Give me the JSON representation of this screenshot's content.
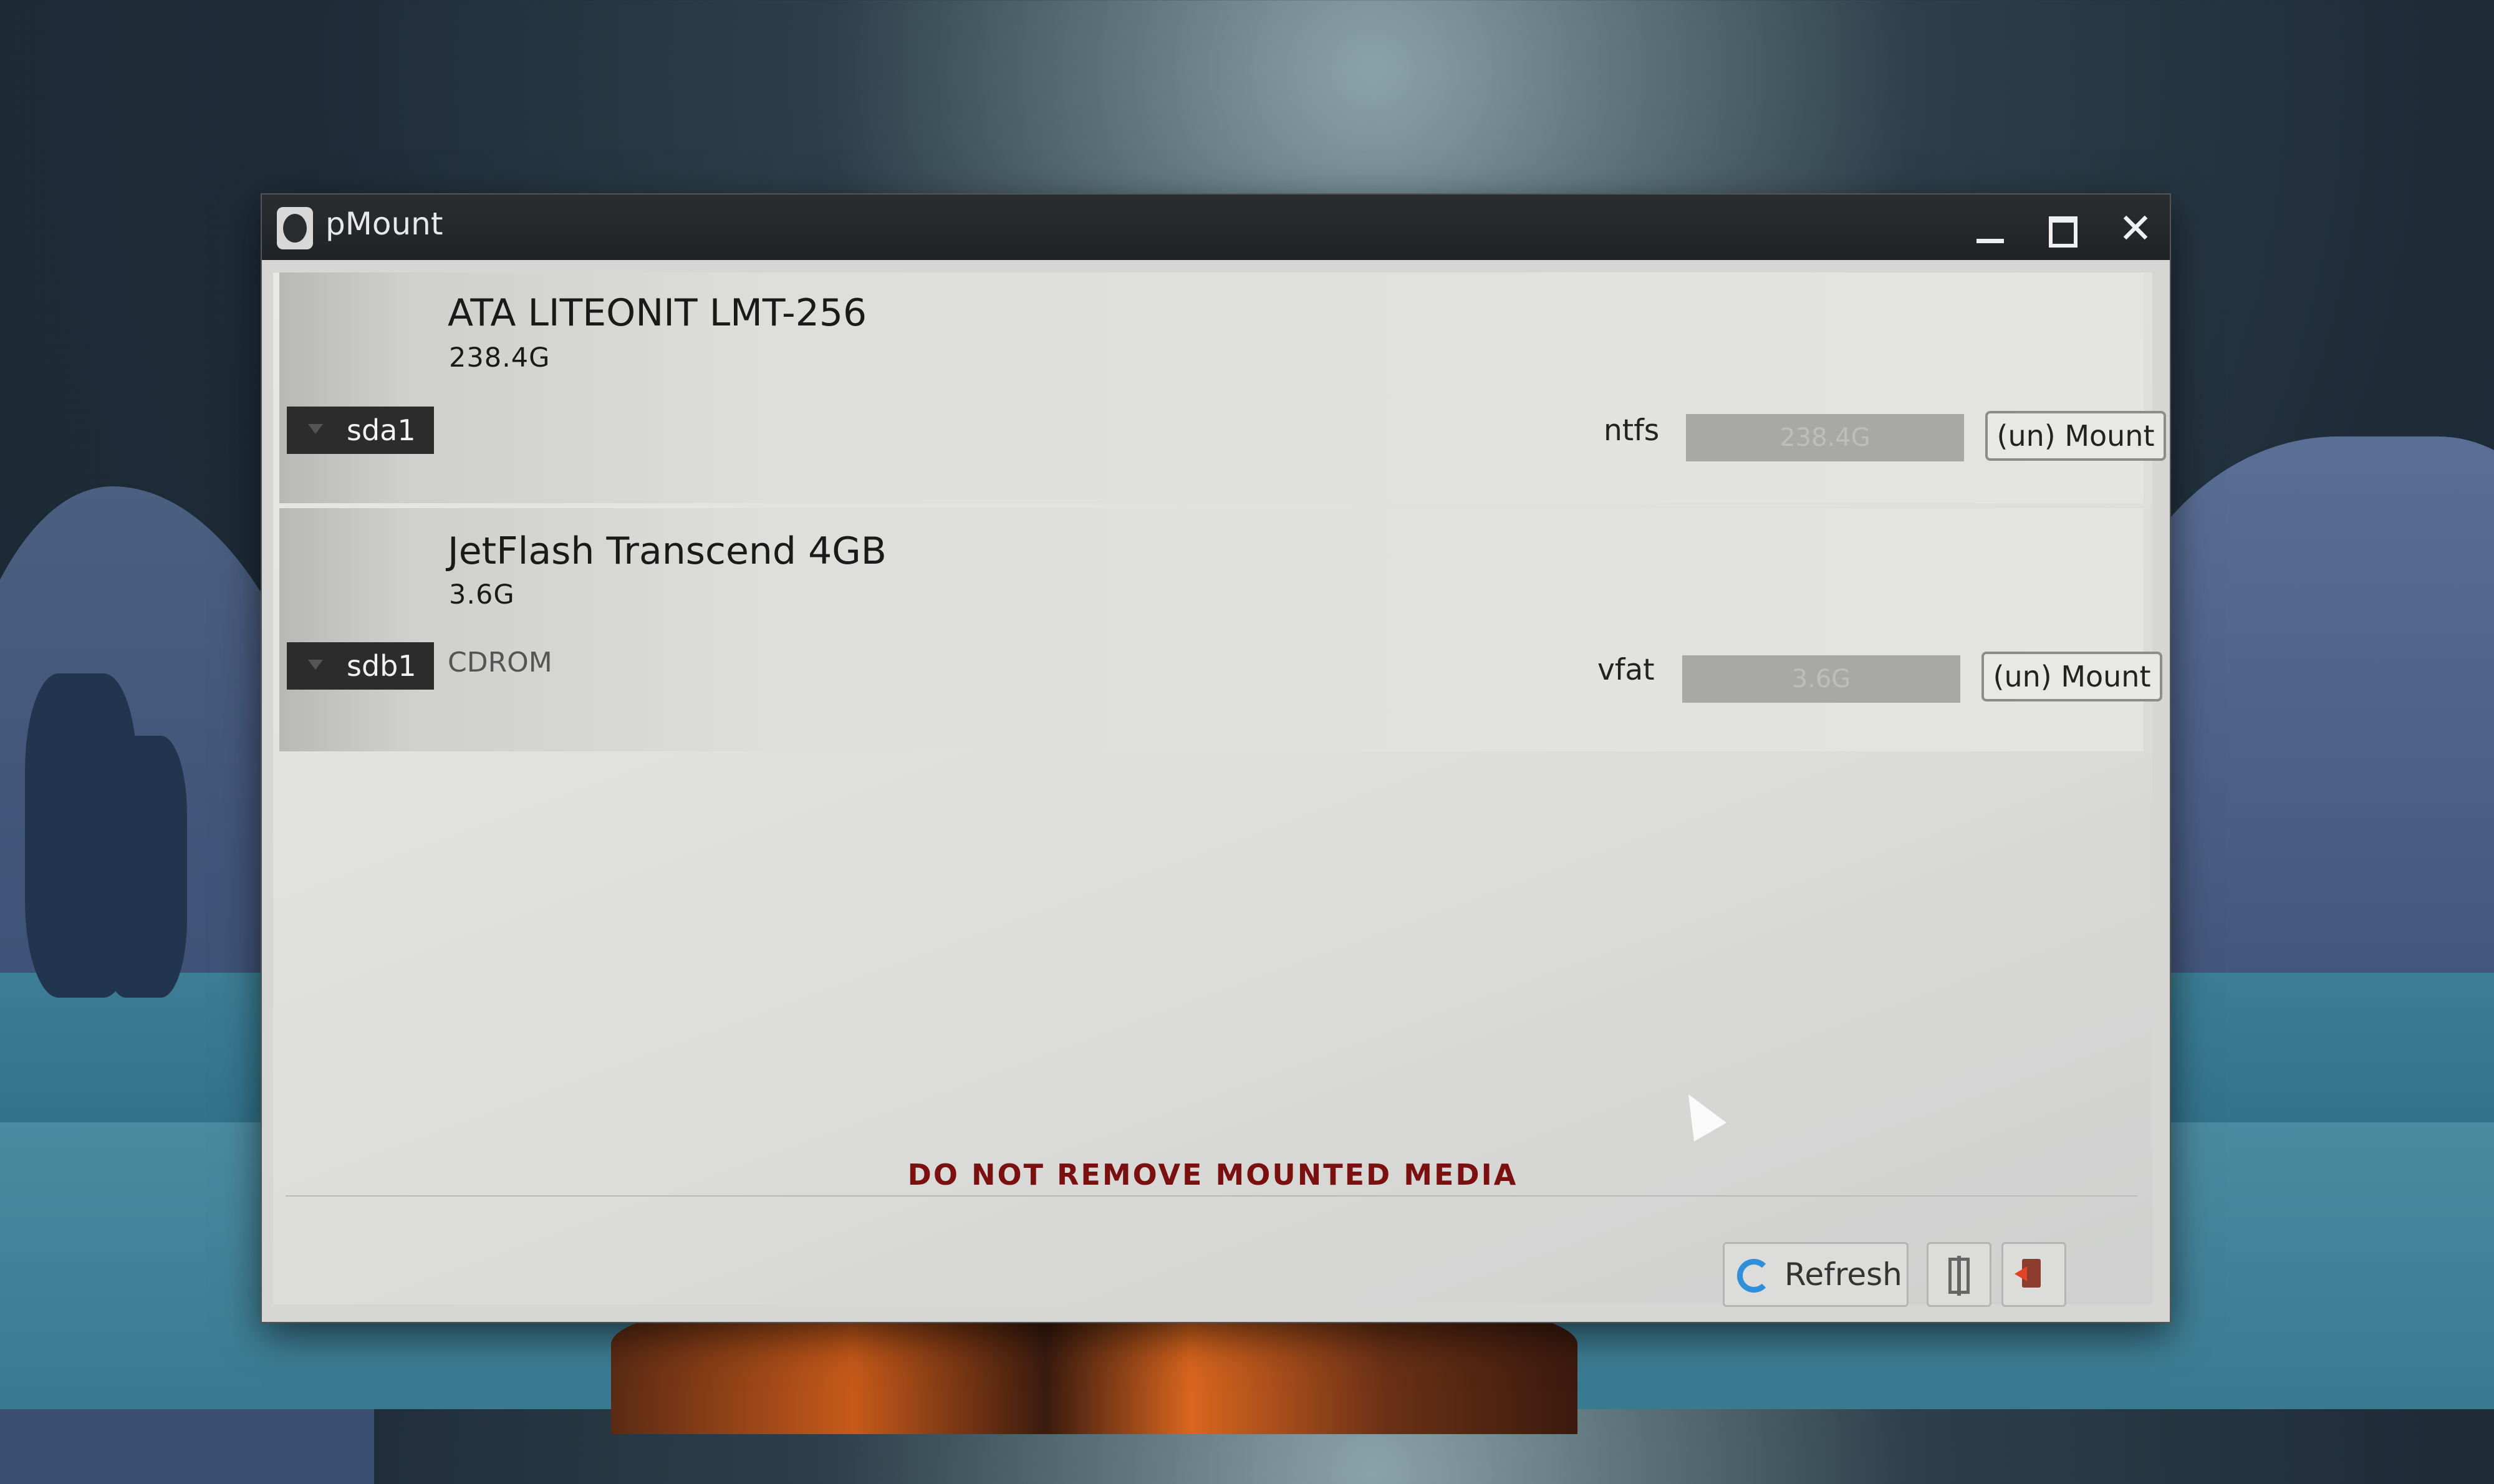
{
  "window": {
    "title": "pMount",
    "controls": {
      "minimize": "minimize",
      "maximize": "maximize",
      "close": "✕"
    }
  },
  "devices": [
    {
      "name": "ATA LITEONIT LMT-256",
      "size": "238.4G",
      "partition": {
        "id": "sda1",
        "label": "",
        "fs": "ntfs",
        "usage_text": "238.4G",
        "mount_label": "(un) Mount"
      }
    },
    {
      "name": "JetFlash Transcend 4GB",
      "size": "3.6G",
      "partition": {
        "id": "sdb1",
        "label": "CDROM",
        "fs": "vfat",
        "usage_text": "3.6G",
        "mount_label": "(un) Mount"
      }
    }
  ],
  "warning": "DO NOT REMOVE MOUNTED MEDIA",
  "toolbar": {
    "refresh_label": "Refresh",
    "refresh_icon": "refresh-icon",
    "settings_icon": "settings-icon",
    "exit_icon": "exit-icon"
  },
  "colors": {
    "warning": "#7a1010",
    "refresh_icon": "#2f8fd8",
    "exit_icon": "#e04424"
  }
}
